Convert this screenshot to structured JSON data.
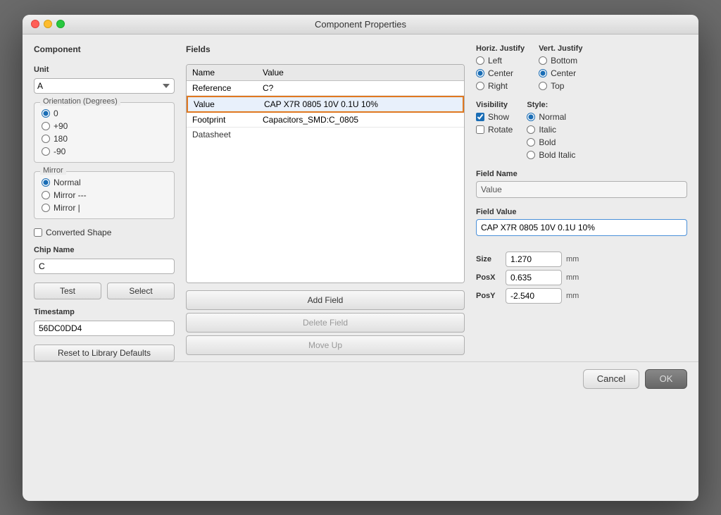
{
  "window": {
    "title": "Component Properties"
  },
  "left_panel": {
    "title": "Component",
    "unit_label": "Unit",
    "unit_value": "A",
    "orientation_label": "Orientation (Degrees)",
    "orientations": [
      {
        "label": "0",
        "checked": true
      },
      {
        "label": "+90",
        "checked": false
      },
      {
        "label": "180",
        "checked": false
      },
      {
        "label": "-90",
        "checked": false
      }
    ],
    "mirror_label": "Mirror",
    "mirrors": [
      {
        "label": "Normal",
        "checked": true
      },
      {
        "label": "Mirror ---",
        "checked": false
      },
      {
        "label": "Mirror |",
        "checked": false
      }
    ],
    "converted_shape_label": "Converted Shape",
    "converted_shape_checked": false,
    "chip_name_label": "Chip Name",
    "chip_name_value": "C",
    "test_btn": "Test",
    "select_btn": "Select",
    "timestamp_label": "Timestamp",
    "timestamp_value": "56DC0DD4",
    "reset_btn": "Reset to Library Defaults"
  },
  "fields_panel": {
    "title": "Fields",
    "columns": [
      "Name",
      "Value"
    ],
    "rows": [
      {
        "name": "Reference",
        "value": "C?",
        "selected": false
      },
      {
        "name": "Value",
        "value": "CAP X7R 0805 10V 0.1U 10%",
        "selected": true
      },
      {
        "name": "Footprint",
        "value": "Capacitors_SMD:C_0805",
        "selected": false
      },
      {
        "name": "Datasheet",
        "value": "",
        "selected": false
      }
    ],
    "add_field_btn": "Add Field",
    "delete_field_btn": "Delete Field",
    "move_up_btn": "Move Up"
  },
  "right_panel": {
    "horiz_justify_label": "Horiz. Justify",
    "horiz_options": [
      {
        "label": "Left",
        "checked": false
      },
      {
        "label": "Center",
        "checked": true
      },
      {
        "label": "Right",
        "checked": false
      }
    ],
    "vert_justify_label": "Vert. Justify",
    "vert_options": [
      {
        "label": "Bottom",
        "checked": false
      },
      {
        "label": "Center",
        "checked": true
      },
      {
        "label": "Top",
        "checked": false
      }
    ],
    "visibility_label": "Visibility",
    "show_label": "Show",
    "show_checked": true,
    "rotate_label": "Rotate",
    "rotate_checked": false,
    "style_label": "Style:",
    "style_options": [
      {
        "label": "Normal",
        "checked": true
      },
      {
        "label": "Italic",
        "checked": false
      },
      {
        "label": "Bold",
        "checked": false
      },
      {
        "label": "Bold Italic",
        "checked": false
      }
    ],
    "field_name_label": "Field Name",
    "field_name_value": "Value",
    "field_value_label": "Field Value",
    "field_value_value": "CAP X7R 0805 10V 0.1U 10%",
    "size_label": "Size",
    "size_value": "1.270",
    "posx_label": "PosX",
    "posx_value": "0.635",
    "posy_label": "PosY",
    "posy_value": "-2.540",
    "unit": "mm"
  },
  "buttons": {
    "cancel": "Cancel",
    "ok": "OK"
  }
}
